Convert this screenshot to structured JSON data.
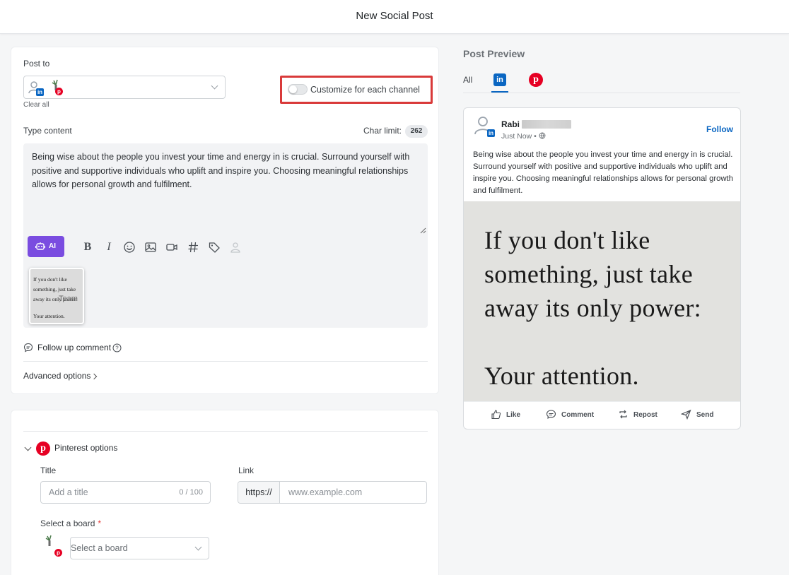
{
  "header": {
    "title": "New Social Post"
  },
  "composer": {
    "post_to_label": "Post to",
    "clear_all": "Clear all",
    "customize_label": "Customize for each channel",
    "type_content_label": "Type content",
    "char_limit_label": "Char limit:",
    "char_limit_value": "262",
    "content": "Being wise about the people you invest your time and energy in is crucial. Surround yourself with positive and supportive individuals who uplift and inspire you. Choosing meaningful relationships allows for personal growth and fulfilment.",
    "ai_label": "AI",
    "attachment_overlay": "Team",
    "attachment_lines": [
      "If you don't like",
      "something, just take",
      "away its only power:",
      "Your attention."
    ],
    "follow_up_label": "Follow up comment",
    "advanced_label": "Advanced options",
    "toolbar_icons": [
      "bold-icon",
      "italic-icon",
      "emoji-icon",
      "image-icon",
      "video-icon",
      "hashtag-icon",
      "tag-icon",
      "mention-icon"
    ]
  },
  "pinterest": {
    "section_label": "Pinterest options",
    "title_label": "Title",
    "title_placeholder": "Add a title",
    "title_counter": "0 / 100",
    "link_label": "Link",
    "link_prefix": "https://",
    "link_placeholder": "www.example.com",
    "board_label": "Select a board",
    "board_required": "*",
    "board_placeholder": "Select a board"
  },
  "preview": {
    "title": "Post Preview",
    "tab_all": "All",
    "account_name": "Rabi",
    "time": "Just Now •",
    "follow": "Follow",
    "text": "Being wise about the people you invest your time and energy in is crucial. Surround yourself with positive and supportive individuals who uplift and inspire you. Choosing meaningful relationships allows for personal growth and fulfilment.",
    "image_quote": [
      "If you don't like",
      "something, just take",
      "away its only power:",
      "Your attention."
    ],
    "actions": {
      "like": "Like",
      "comment": "Comment",
      "repost": "Repost",
      "send": "Send"
    }
  },
  "colors": {
    "accent_ai": "#7a4ce0",
    "linkedin": "#0a66c2",
    "pinterest": "#e60023",
    "highlight": "#d93a3a"
  }
}
